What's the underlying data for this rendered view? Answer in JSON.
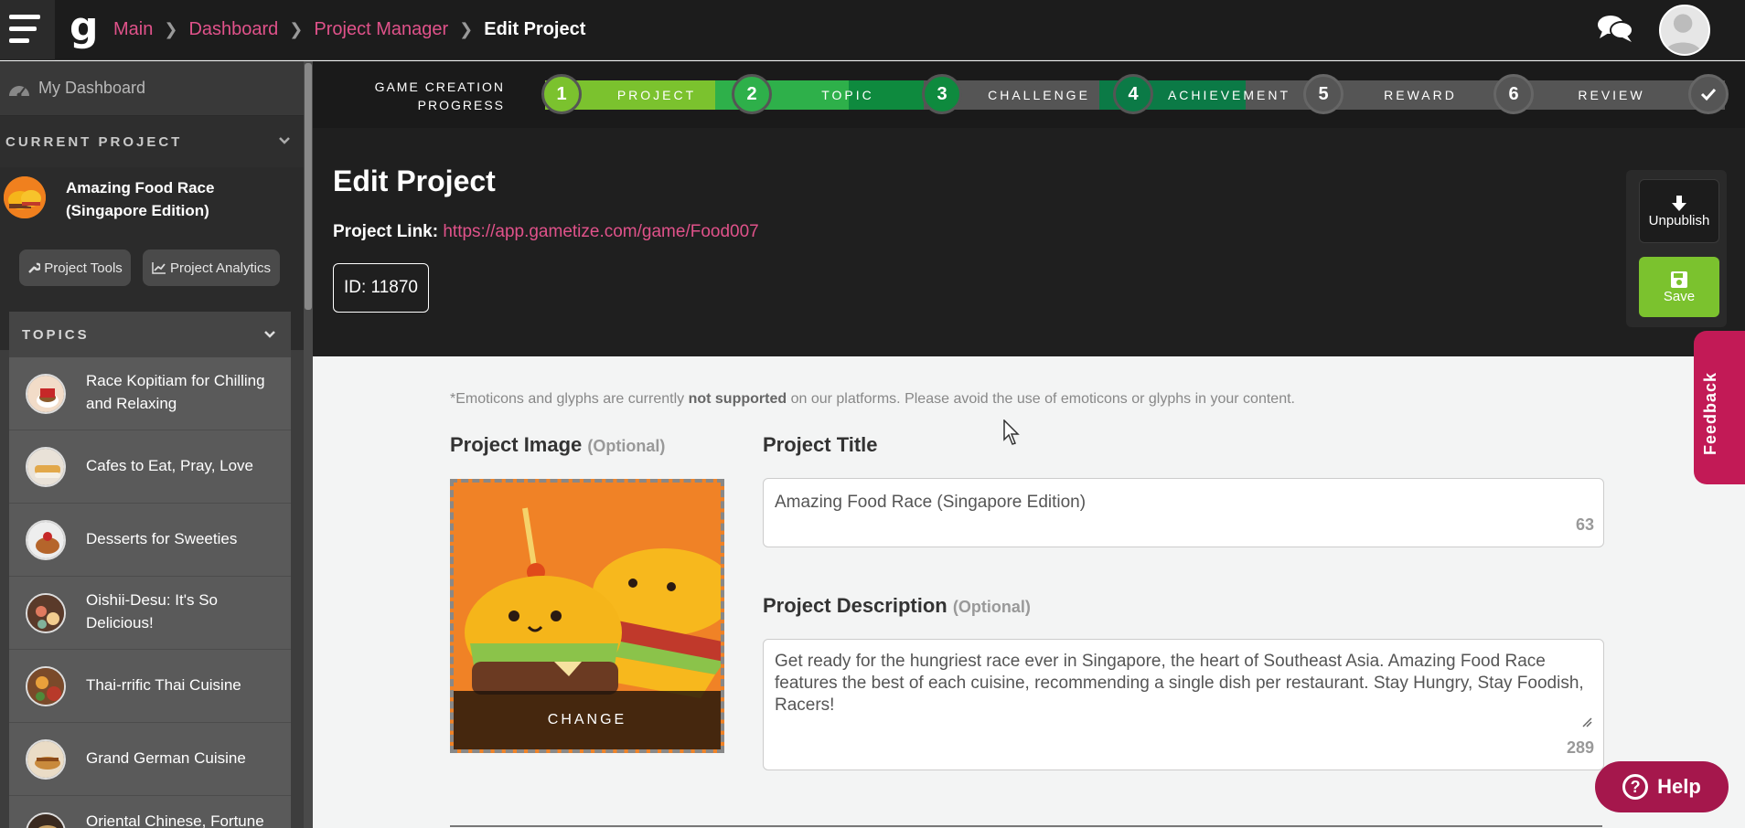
{
  "topbar": {
    "logo": "g",
    "breadcrumbs": [
      "Main",
      "Dashboard",
      "Project Manager",
      "Edit Project"
    ]
  },
  "sidebar": {
    "my_dashboard": "My Dashboard",
    "current_project_heading": "CURRENT PROJECT",
    "project_name": "Amazing Food Race (Singapore Edition)",
    "project_tools": "Project Tools",
    "project_analytics": "Project Analytics",
    "topics_heading": "TOPICS",
    "topics": [
      {
        "label": "Race Kopitiam for Chilling and Relaxing"
      },
      {
        "label": "Cafes to Eat, Pray, Love"
      },
      {
        "label": "Desserts for Sweeties"
      },
      {
        "label": "Oishii-Desu: It's So Delicious!"
      },
      {
        "label": "Thai-rrific Thai Cuisine"
      },
      {
        "label": "Grand German Cuisine"
      },
      {
        "label": "Oriental Chinese, Fortune"
      }
    ]
  },
  "progress": {
    "label_line1": "GAME CREATION",
    "label_line2": "PROGRESS",
    "steps": [
      {
        "num": "1",
        "label": "PROJECT",
        "status": "done"
      },
      {
        "num": "2",
        "label": "TOPIC",
        "status": "done"
      },
      {
        "num": "3",
        "label": "CHALLENGE",
        "status": "done"
      },
      {
        "num": "4",
        "label": "ACHIEVEMENT",
        "status": "done"
      },
      {
        "num": "5",
        "label": "REWARD",
        "status": "pending"
      },
      {
        "num": "6",
        "label": "REVIEW",
        "status": "pending"
      }
    ],
    "colors": {
      "light_green": "#7bc22e",
      "mid_green": "#2eb04a",
      "dark_green": "#0e8a3e",
      "deep_green": "#0b7a46",
      "pending": "#555555"
    }
  },
  "header": {
    "title": "Edit Project",
    "project_link_label": "Project Link:",
    "project_link_url": "https://app.gametize.com/game/Food007",
    "id_label": "ID: 11870"
  },
  "actions": {
    "unpublish": "Unpublish",
    "save": "Save"
  },
  "form": {
    "notice_pre": "*Emoticons and glyphs are currently ",
    "notice_bold": "not supported",
    "notice_post": " on our platforms. Please avoid the use of emoticons or glyphs in your content.",
    "image_label": "Project Image",
    "optional": "(Optional)",
    "change_label": "CHANGE",
    "title_label": "Project Title",
    "title_value": "Amazing Food Race (Singapore Edition)",
    "title_count": "63",
    "desc_label": "Project Description",
    "desc_value": "Get ready for the hungriest race ever in Singapore, the heart of Southeast Asia. Amazing Food Race features the best of each cuisine, recommending a single dish per restaurant. Stay Hungry, Stay Foodish, Racers!",
    "desc_count": "289"
  },
  "widgets": {
    "feedback": "Feedback",
    "help": "Help"
  }
}
